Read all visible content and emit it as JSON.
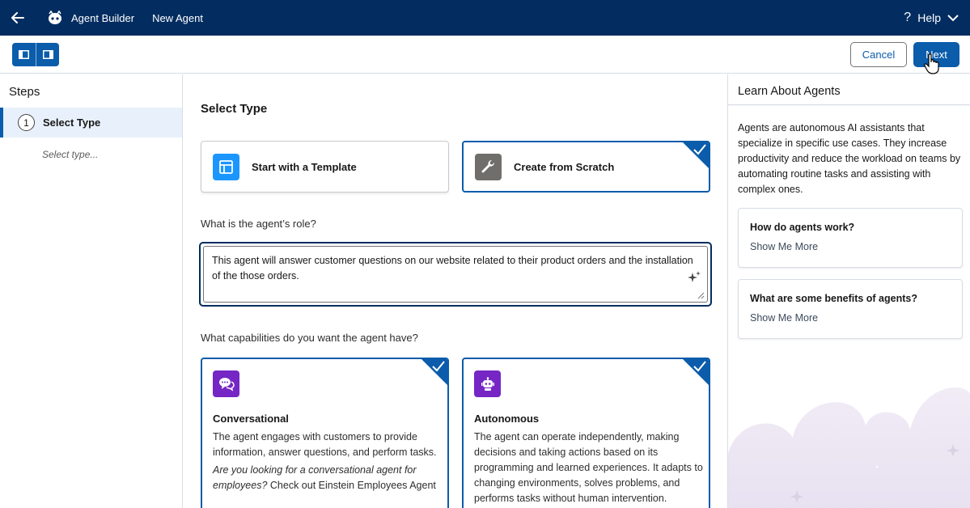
{
  "topbar": {
    "app_title": "Agent Builder",
    "page_title": "New Agent",
    "help_label": "Help"
  },
  "toolbar": {
    "cancel_label": "Cancel",
    "next_label": "Next"
  },
  "sidebar": {
    "title": "Steps",
    "steps": [
      {
        "number": "1",
        "label": "Select Type",
        "sub": "Select type..."
      }
    ]
  },
  "main": {
    "section_title": "Select Type",
    "type_options": [
      {
        "label": "Start with a Template",
        "selected": false
      },
      {
        "label": "Create from Scratch",
        "selected": true
      }
    ],
    "role_label": "What is the agent’s role?",
    "role_value": "This agent will answer customer questions on our website related to their product orders and the installation of the those orders.",
    "capabilities_label": "What capabilities do you want the agent have?",
    "capabilities": [
      {
        "title": "Conversational",
        "description": "The agent engages with customers to provide information, answer questions, and perform tasks.",
        "note_italic": "Are you looking for a conversational agent for employees?",
        "note_link": "Check out Einstein Employees Agent",
        "selected": true
      },
      {
        "title": "Autonomous",
        "description": "The agent can operate independently, making decisions and taking actions based on its programming and learned experiences. It adapts to changing environments, solves problems, and performs tasks without human intervention.",
        "selected": true
      }
    ]
  },
  "right_panel": {
    "title": "Learn About Agents",
    "intro": "Agents are autonomous AI assistants that specialize in specific use cases. They increase productivity and reduce the workload on teams by automating routine tasks and assisting with complex ones.",
    "cards": [
      {
        "question": "How do agents work?",
        "link": "Show Me More"
      },
      {
        "question": "What are some benefits of agents?",
        "link": "Show Me More"
      }
    ]
  },
  "colors": {
    "nav_bg": "#032d60",
    "brand_blue": "#0b5cab",
    "template_icon": "#1b96ff",
    "scratch_icon": "#706e6b",
    "capability_icon": "#7526c4"
  },
  "icons": [
    "back-arrow-icon",
    "agent-logo-icon",
    "help-icon",
    "chevron-down-icon",
    "panel-left-icon",
    "panel-right-icon",
    "template-icon",
    "wrench-icon",
    "sparkle-icon",
    "chat-icon",
    "robot-icon",
    "checkmark-icon"
  ]
}
